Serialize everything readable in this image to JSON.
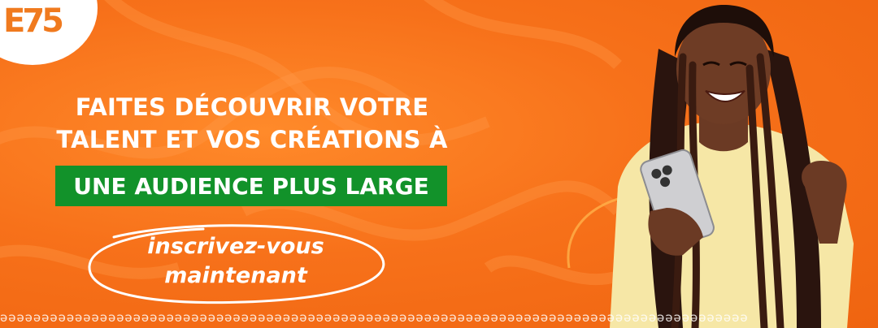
{
  "logo": {
    "text": "E75",
    "color": "#f07a1e",
    "badge_color": "#ffffff"
  },
  "headline": {
    "line1": "FAITES DÉCOUVRIR VOTRE",
    "line2": "TALENT ET VOS CRÉATIONS À"
  },
  "highlight": {
    "text": "UNE AUDIENCE PLUS LARGE",
    "color": "#12922a"
  },
  "cta": {
    "line1": "inscrivez-vous",
    "line2": "maintenant"
  },
  "colors": {
    "background": "#f7711a",
    "accent_green": "#12922a",
    "text": "#ffffff"
  },
  "photo": {
    "description_icon": "woman-with-phone-image"
  },
  "pattern": {
    "glyph": "ә"
  }
}
